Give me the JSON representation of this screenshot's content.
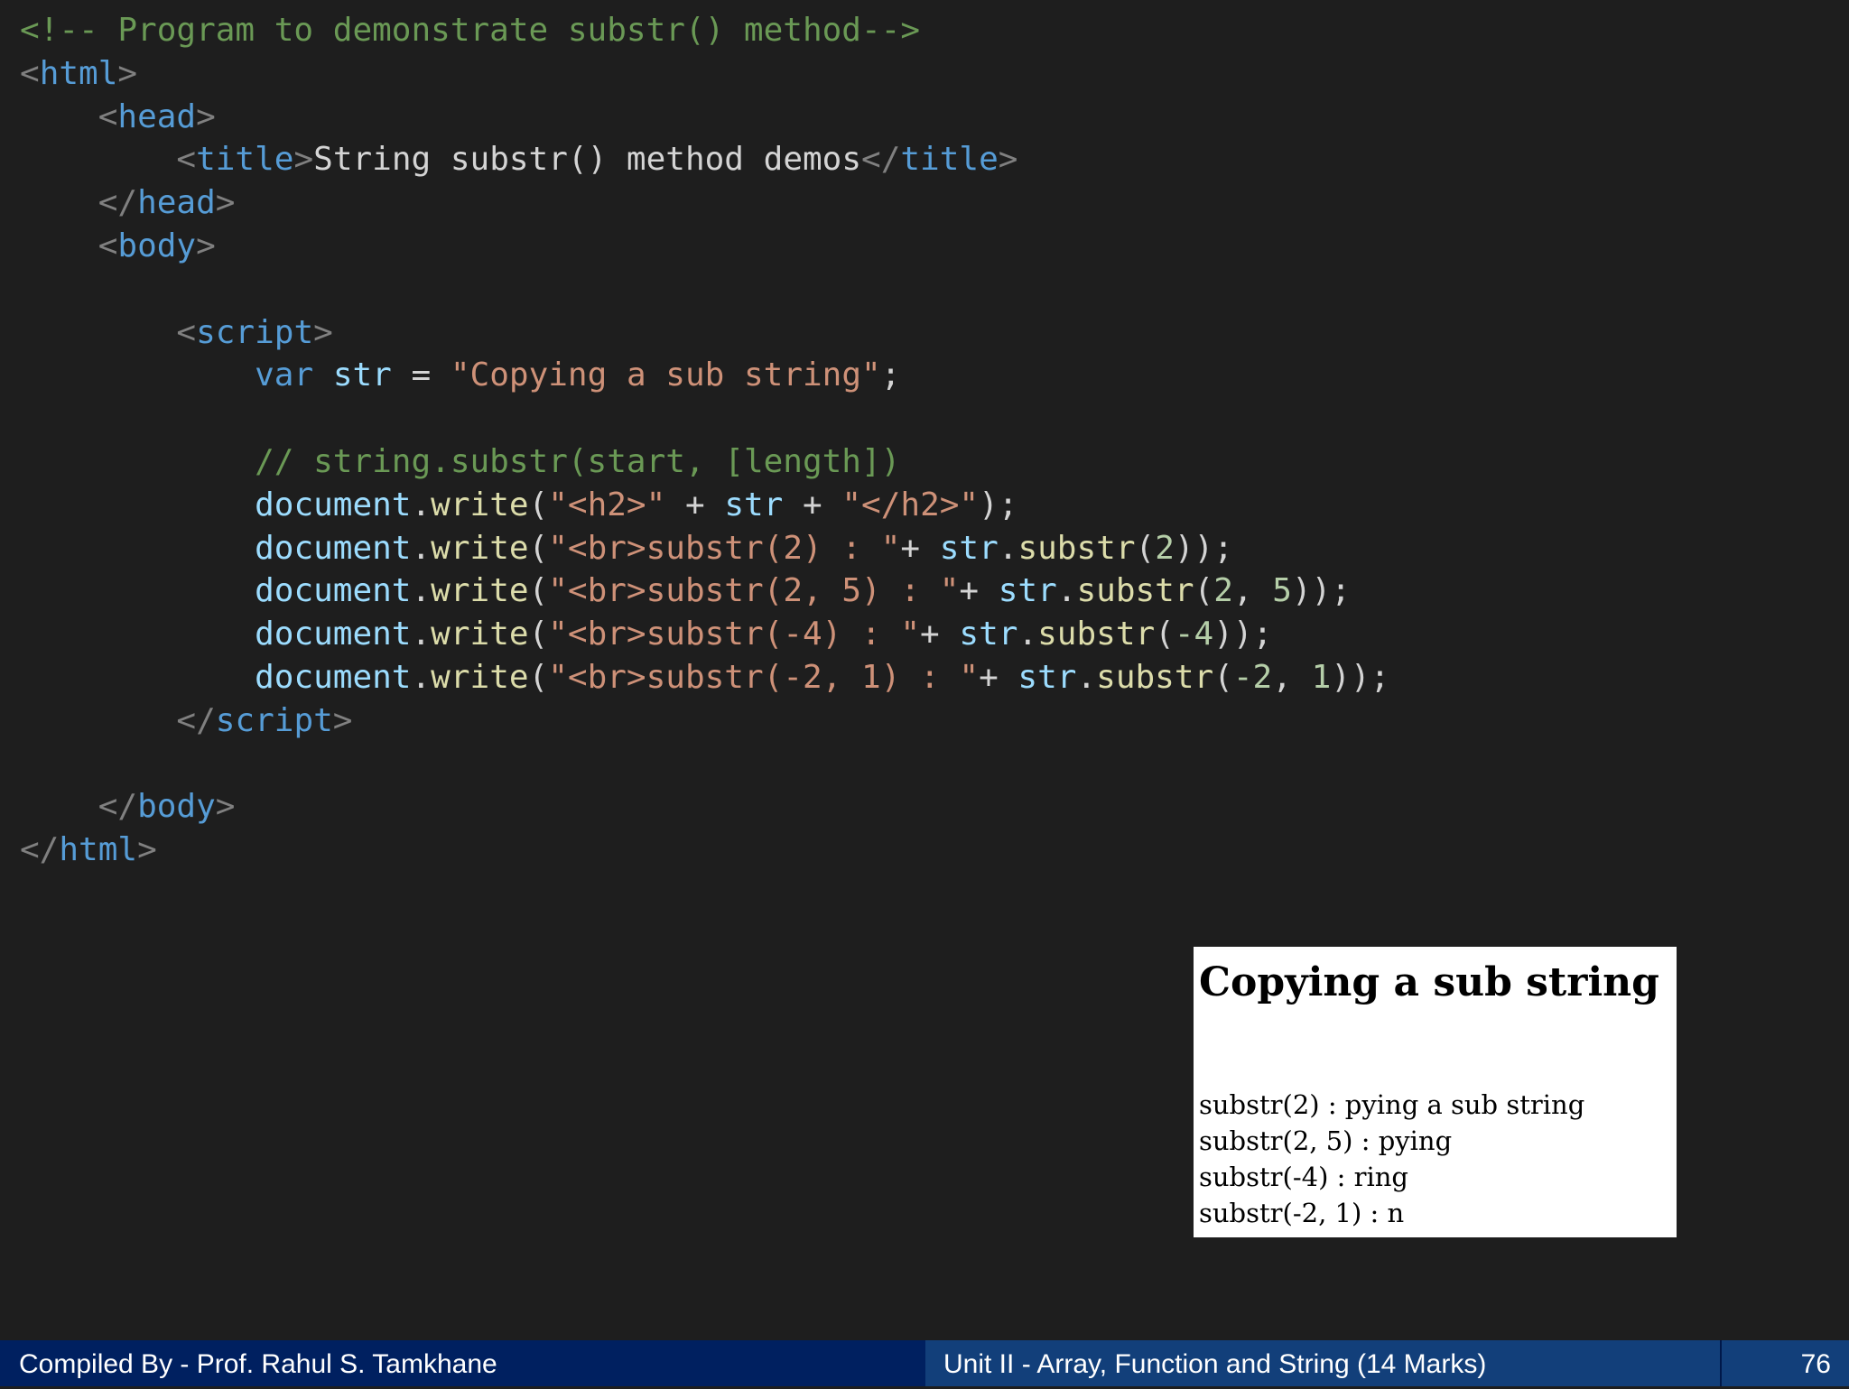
{
  "code_lines": [
    [
      {
        "t": "<!-- Program to demonstrate substr() method-->",
        "c": "cm"
      }
    ],
    [
      {
        "t": "<",
        "c": "br"
      },
      {
        "t": "html",
        "c": "tg"
      },
      {
        "t": ">",
        "c": "br"
      }
    ],
    [
      {
        "t": "    "
      },
      {
        "t": "<",
        "c": "br"
      },
      {
        "t": "head",
        "c": "tg"
      },
      {
        "t": ">",
        "c": "br"
      }
    ],
    [
      {
        "t": "        "
      },
      {
        "t": "<",
        "c": "br"
      },
      {
        "t": "title",
        "c": "tg"
      },
      {
        "t": ">",
        "c": "br"
      },
      {
        "t": "String substr() method demos",
        "c": "tx"
      },
      {
        "t": "</",
        "c": "br"
      },
      {
        "t": "title",
        "c": "tg"
      },
      {
        "t": ">",
        "c": "br"
      }
    ],
    [
      {
        "t": "    "
      },
      {
        "t": "</",
        "c": "br"
      },
      {
        "t": "head",
        "c": "tg"
      },
      {
        "t": ">",
        "c": "br"
      }
    ],
    [
      {
        "t": "    "
      },
      {
        "t": "<",
        "c": "br"
      },
      {
        "t": "body",
        "c": "tg"
      },
      {
        "t": ">",
        "c": "br"
      }
    ],
    [],
    [
      {
        "t": "        "
      },
      {
        "t": "<",
        "c": "br"
      },
      {
        "t": "script",
        "c": "tg"
      },
      {
        "t": ">",
        "c": "br"
      }
    ],
    [
      {
        "t": "            "
      },
      {
        "t": "var",
        "c": "kw"
      },
      {
        "t": " "
      },
      {
        "t": "str",
        "c": "id"
      },
      {
        "t": " = ",
        "c": "pn"
      },
      {
        "t": "\"Copying a sub string\"",
        "c": "st"
      },
      {
        "t": ";",
        "c": "pn"
      }
    ],
    [],
    [
      {
        "t": "            "
      },
      {
        "t": "// string.substr(start, [length])",
        "c": "cm"
      }
    ],
    [
      {
        "t": "            "
      },
      {
        "t": "document",
        "c": "id"
      },
      {
        "t": ".",
        "c": "pn"
      },
      {
        "t": "write",
        "c": "fn"
      },
      {
        "t": "(",
        "c": "pn"
      },
      {
        "t": "\"<h2>\"",
        "c": "st"
      },
      {
        "t": " + ",
        "c": "pn"
      },
      {
        "t": "str",
        "c": "id"
      },
      {
        "t": " + ",
        "c": "pn"
      },
      {
        "t": "\"</h2>\"",
        "c": "st"
      },
      {
        "t": ");",
        "c": "pn"
      }
    ],
    [
      {
        "t": "            "
      },
      {
        "t": "document",
        "c": "id"
      },
      {
        "t": ".",
        "c": "pn"
      },
      {
        "t": "write",
        "c": "fn"
      },
      {
        "t": "(",
        "c": "pn"
      },
      {
        "t": "\"<br>substr(2) : \"",
        "c": "st"
      },
      {
        "t": "+ ",
        "c": "pn"
      },
      {
        "t": "str",
        "c": "id"
      },
      {
        "t": ".",
        "c": "pn"
      },
      {
        "t": "substr",
        "c": "fn"
      },
      {
        "t": "(",
        "c": "pn"
      },
      {
        "t": "2",
        "c": "nm"
      },
      {
        "t": "));",
        "c": "pn"
      }
    ],
    [
      {
        "t": "            "
      },
      {
        "t": "document",
        "c": "id"
      },
      {
        "t": ".",
        "c": "pn"
      },
      {
        "t": "write",
        "c": "fn"
      },
      {
        "t": "(",
        "c": "pn"
      },
      {
        "t": "\"<br>substr(2, 5) : \"",
        "c": "st"
      },
      {
        "t": "+ ",
        "c": "pn"
      },
      {
        "t": "str",
        "c": "id"
      },
      {
        "t": ".",
        "c": "pn"
      },
      {
        "t": "substr",
        "c": "fn"
      },
      {
        "t": "(",
        "c": "pn"
      },
      {
        "t": "2",
        "c": "nm"
      },
      {
        "t": ", ",
        "c": "pn"
      },
      {
        "t": "5",
        "c": "nm"
      },
      {
        "t": "));",
        "c": "pn"
      }
    ],
    [
      {
        "t": "            "
      },
      {
        "t": "document",
        "c": "id"
      },
      {
        "t": ".",
        "c": "pn"
      },
      {
        "t": "write",
        "c": "fn"
      },
      {
        "t": "(",
        "c": "pn"
      },
      {
        "t": "\"<br>substr(-4) : \"",
        "c": "st"
      },
      {
        "t": "+ ",
        "c": "pn"
      },
      {
        "t": "str",
        "c": "id"
      },
      {
        "t": ".",
        "c": "pn"
      },
      {
        "t": "substr",
        "c": "fn"
      },
      {
        "t": "(",
        "c": "pn"
      },
      {
        "t": "-4",
        "c": "nm"
      },
      {
        "t": "));",
        "c": "pn"
      }
    ],
    [
      {
        "t": "            "
      },
      {
        "t": "document",
        "c": "id"
      },
      {
        "t": ".",
        "c": "pn"
      },
      {
        "t": "write",
        "c": "fn"
      },
      {
        "t": "(",
        "c": "pn"
      },
      {
        "t": "\"<br>substr(-2, 1) : \"",
        "c": "st"
      },
      {
        "t": "+ ",
        "c": "pn"
      },
      {
        "t": "str",
        "c": "id"
      },
      {
        "t": ".",
        "c": "pn"
      },
      {
        "t": "substr",
        "c": "fn"
      },
      {
        "t": "(",
        "c": "pn"
      },
      {
        "t": "-2",
        "c": "nm"
      },
      {
        "t": ", ",
        "c": "pn"
      },
      {
        "t": "1",
        "c": "nm"
      },
      {
        "t": "));",
        "c": "pn"
      }
    ],
    [
      {
        "t": "        "
      },
      {
        "t": "</",
        "c": "br"
      },
      {
        "t": "script",
        "c": "tg"
      },
      {
        "t": ">",
        "c": "br"
      }
    ],
    [],
    [
      {
        "t": "    "
      },
      {
        "t": "</",
        "c": "br"
      },
      {
        "t": "body",
        "c": "tg"
      },
      {
        "t": ">",
        "c": "br"
      }
    ],
    [
      {
        "t": "</",
        "c": "br"
      },
      {
        "t": "html",
        "c": "tg"
      },
      {
        "t": ">",
        "c": "br"
      }
    ]
  ],
  "output": {
    "heading": "Copying a sub string",
    "lines": [
      "substr(2) : pying a sub string",
      "substr(2, 5) : pying",
      "substr(-4) : ring",
      "substr(-2, 1) : n"
    ]
  },
  "footer": {
    "left": "Compiled By - Prof. Rahul S. Tamkhane",
    "middle": "Unit II - Array, Function and String (14 Marks)",
    "page_number": "76"
  },
  "colors": {
    "background": "#1e1e1e",
    "comment": "#6a9955",
    "tag": "#569cd6",
    "string": "#ce9178",
    "footer_dark": "#002060",
    "footer_light": "#123f7a"
  }
}
